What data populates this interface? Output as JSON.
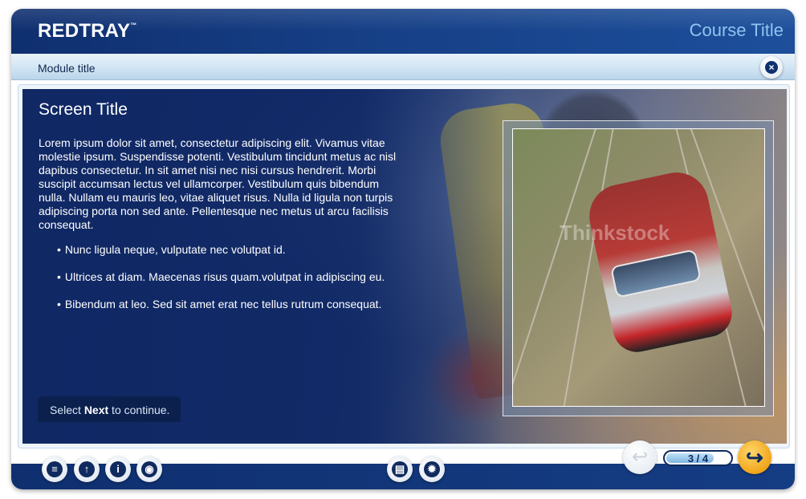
{
  "header": {
    "logo": "REDTRAY",
    "logo_tm": "™",
    "course_title": "Course Title"
  },
  "module_bar": {
    "module_title": "Module title",
    "close_icon": "close-icon"
  },
  "screen": {
    "title": "Screen Title",
    "body": "Lorem ipsum dolor sit amet, consectetur adipiscing elit. Vivamus vitae molestie ipsum. Suspendisse potenti. Vestibulum tincidunt metus ac nisl dapibus consectetur. In sit amet nisi nec nisi cursus hendrerit. Morbi suscipit accumsan lectus vel ullamcorper. Vestibulum quis bibendum nulla. Nullam eu mauris leo, vitae aliquet risus. Nulla id ligula non turpis adipiscing porta non sed ante. Pellentesque nec metus ut arcu facilisis consequat.",
    "bullets": [
      "Nunc ligula neque, vulputate nec volutpat id.",
      "Ultrices at diam. Maecenas risus quam.volutpat in adipiscing eu.",
      "Bibendum at leo. Sed sit amet erat nec tellus rutrum consequat."
    ],
    "continue_prefix": "Select ",
    "continue_next": "Next",
    "continue_suffix": " to continue.",
    "photo_watermark": "Thinkstock"
  },
  "footer": {
    "left_buttons": [
      {
        "name": "menu-button",
        "icon": "list-icon",
        "glyph": "≡"
      },
      {
        "name": "up-button",
        "icon": "up-arrow-icon",
        "glyph": "↑"
      },
      {
        "name": "info-button",
        "icon": "info-icon",
        "glyph": "i"
      },
      {
        "name": "view-button",
        "icon": "eye-icon",
        "glyph": "◉"
      }
    ],
    "center_buttons": [
      {
        "name": "print-button",
        "icon": "printer-icon",
        "glyph": "▤"
      },
      {
        "name": "settings-button",
        "icon": "gear-icon",
        "glyph": "✹"
      }
    ],
    "back_glyph": "↩",
    "page_counter": "3 / 4",
    "page_progress": 0.75,
    "next_glyph": "↪"
  },
  "colors": {
    "brand_navy": "#0f2f6f",
    "accent_light_blue": "#8fc3ef",
    "next_orange": "#f2a51a"
  }
}
